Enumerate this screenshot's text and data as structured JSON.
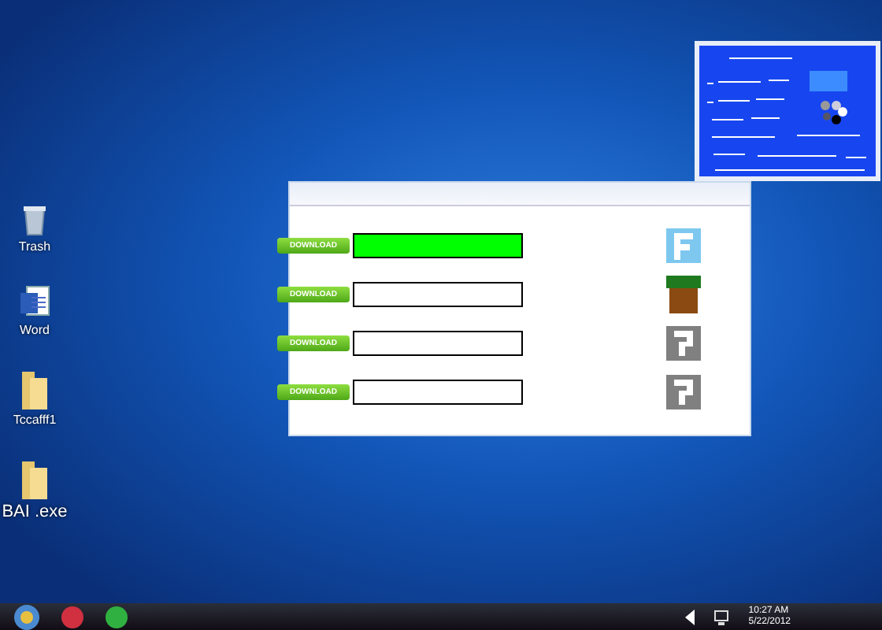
{
  "desktop_icons": [
    {
      "kind": "trash",
      "label": "Trash"
    },
    {
      "kind": "word",
      "label": "Word"
    },
    {
      "kind": "folder",
      "label": "Tccafff1"
    },
    {
      "kind": "folder",
      "label": "BAI .exe"
    }
  ],
  "downloads": [
    {
      "button": "DOWNLOAD",
      "level": 1,
      "kind": "f-tile"
    },
    {
      "button": "DOWNLOAD",
      "level": 0,
      "kind": "dirt-block"
    },
    {
      "button": "DOWNLOAD",
      "level": 0,
      "kind": "question-tile"
    },
    {
      "button": "DOWNLOAD",
      "level": 0,
      "kind": "question-tile"
    }
  ],
  "clock": {
    "time": "10:27 AM",
    "date": "5/22/2012"
  }
}
